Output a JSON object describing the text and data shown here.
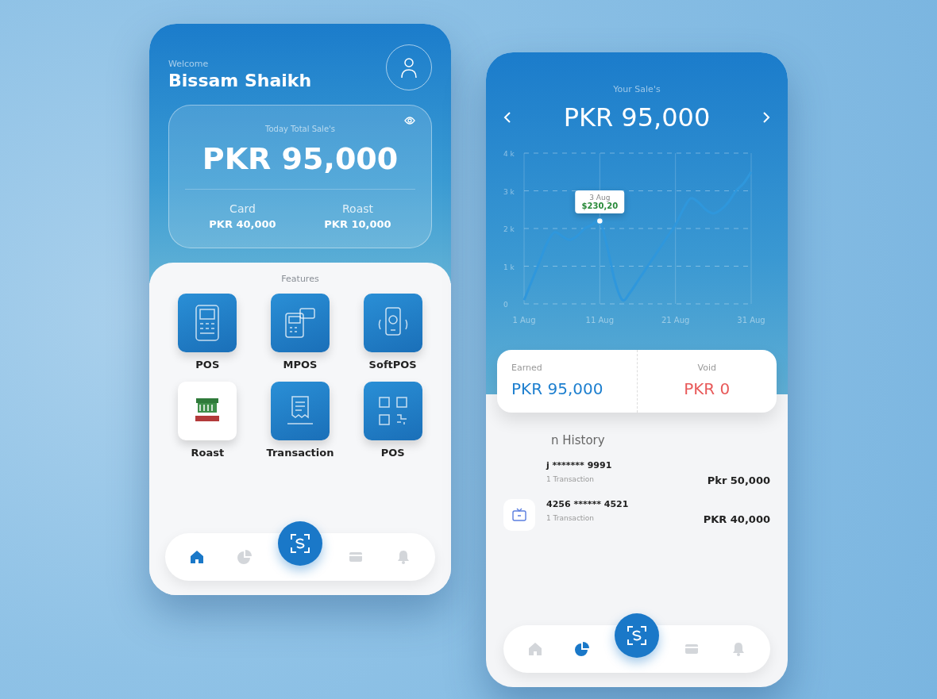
{
  "welcome_screen": {
    "greeting": "Welcome",
    "user_name": "Bissam Shaikh",
    "sales_card": {
      "title": "Today Total Sale's",
      "amount": "PKR 95,000",
      "breakdown": [
        {
          "label": "Card",
          "amount": "PKR 40,000"
        },
        {
          "label": "Roast",
          "amount": "PKR 10,000"
        }
      ]
    },
    "features": {
      "title": "Features",
      "items": [
        {
          "label": "POS",
          "kind": "terminal"
        },
        {
          "label": "MPOS",
          "kind": "card-reader"
        },
        {
          "label": "SoftPOS",
          "kind": "phone"
        },
        {
          "label": "Roast",
          "kind": "logo"
        },
        {
          "label": "Transaction",
          "kind": "receipt"
        },
        {
          "label": "POS",
          "kind": "grid"
        }
      ]
    },
    "nav": [
      {
        "kind": "home",
        "selected": true
      },
      {
        "kind": "pie",
        "selected": false
      },
      {
        "kind": "card",
        "selected": false
      },
      {
        "kind": "bell",
        "selected": false
      }
    ]
  },
  "sales_screen": {
    "title": "Your Sale's",
    "amount": "PKR 95,000",
    "chart_data": {
      "type": "line",
      "categories": [
        "1 Aug",
        null,
        null,
        null,
        null,
        null,
        null,
        null,
        null,
        null,
        "11 Aug",
        null,
        null,
        null,
        null,
        null,
        null,
        null,
        null,
        null,
        "21 Aug",
        null,
        null,
        null,
        null,
        null,
        null,
        null,
        null,
        null,
        "31 Aug"
      ],
      "series": [
        {
          "color": "#2f97dc",
          "values": [
            0.1,
            0.6,
            1.1,
            1.6,
            1.9,
            1.8,
            1.7,
            1.8,
            2.0,
            2.1,
            2.2,
            1.5,
            0.6,
            0.1,
            0.3,
            0.6,
            0.9,
            1.2,
            1.5,
            1.8,
            2.1,
            2.5,
            2.8,
            2.7,
            2.5,
            2.4,
            2.5,
            2.7,
            3.0,
            3.2,
            3.5
          ]
        }
      ],
      "ylim": [
        0,
        4
      ],
      "grid": true,
      "annotations": [
        {
          "x": "11 Aug",
          "y": 2.2,
          "text": "3 Aug"
        },
        {
          "x": "11 Aug",
          "y": 2.2,
          "text": "$230,20"
        }
      ],
      "yticks": [
        {
          "value": 0,
          "label": "0"
        },
        {
          "value": 1,
          "label": "1 k"
        },
        {
          "value": 2,
          "label": "2 k"
        },
        {
          "value": 3,
          "label": "3 k"
        },
        {
          "value": 4,
          "label": "4 k"
        }
      ]
    },
    "summary": [
      {
        "label": "Earned",
        "amount": "PKR 95,000",
        "kind": "earned"
      },
      {
        "label": "Void",
        "amount": "PKR 0",
        "kind": "void"
      }
    ],
    "history": {
      "title": "n History",
      "rows": [
        {
          "card": "j ******* 9991",
          "count": "1 Transaction",
          "amount": "Pkr 50,000",
          "has_icon": false
        },
        {
          "card": "4256 ****** 4521",
          "count": "1 Transaction",
          "amount": "PKR 40,000",
          "has_icon": true
        }
      ]
    },
    "nav": [
      {
        "kind": "home",
        "selected": false
      },
      {
        "kind": "pie",
        "selected": true
      },
      {
        "kind": "card",
        "selected": false
      },
      {
        "kind": "bell",
        "selected": false
      }
    ]
  }
}
